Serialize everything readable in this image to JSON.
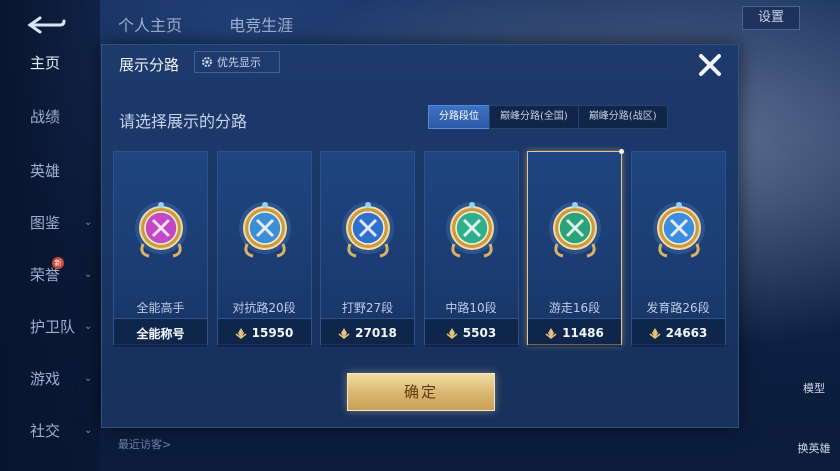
{
  "top_tabs": [
    "个人主页",
    "电竞生涯"
  ],
  "settings_label": "设置",
  "nav": [
    {
      "label": "主页",
      "chevron": false,
      "badge": ""
    },
    {
      "label": "战绩",
      "chevron": false,
      "badge": ""
    },
    {
      "label": "英雄",
      "chevron": false,
      "badge": ""
    },
    {
      "label": "图鉴",
      "chevron": true,
      "badge": ""
    },
    {
      "label": "荣誉",
      "chevron": true,
      "badge": "新"
    },
    {
      "label": "护卫队",
      "chevron": true,
      "badge": ""
    },
    {
      "label": "游戏",
      "chevron": true,
      "badge": ""
    },
    {
      "label": "社交",
      "chevron": true,
      "badge": ""
    }
  ],
  "recent_visitors": "最近访客>",
  "right_labels": [
    "模型",
    "换英雄"
  ],
  "modal": {
    "title": "展示分路",
    "priority_label": "优先显示",
    "subtitle": "请选择展示的分路",
    "segments": [
      "分路段位",
      "巅峰分路(全国)",
      "巅峰分路(战区)"
    ],
    "active_segment": 0,
    "cards": [
      {
        "name": "全能高手",
        "value": "全能称号",
        "show_icon": false,
        "color": "#c447c7",
        "selected": false
      },
      {
        "name": "对抗路20段",
        "value": "15950",
        "show_icon": true,
        "color": "#3b8fd6",
        "selected": false
      },
      {
        "name": "打野27段",
        "value": "27018",
        "show_icon": true,
        "color": "#2f6fd0",
        "selected": false
      },
      {
        "name": "中路10段",
        "value": "5503",
        "show_icon": true,
        "color": "#2fb08c",
        "selected": false
      },
      {
        "name": "游走16段",
        "value": "11486",
        "show_icon": true,
        "color": "#2aa37a",
        "selected": true
      },
      {
        "name": "发育路26段",
        "value": "24663",
        "show_icon": true,
        "color": "#3a8de0",
        "selected": false
      }
    ],
    "confirm_label": "确定"
  },
  "colors": {
    "gold": "#e8c58a",
    "panel": "#1d3a6c",
    "accent": "#3b72c4"
  }
}
